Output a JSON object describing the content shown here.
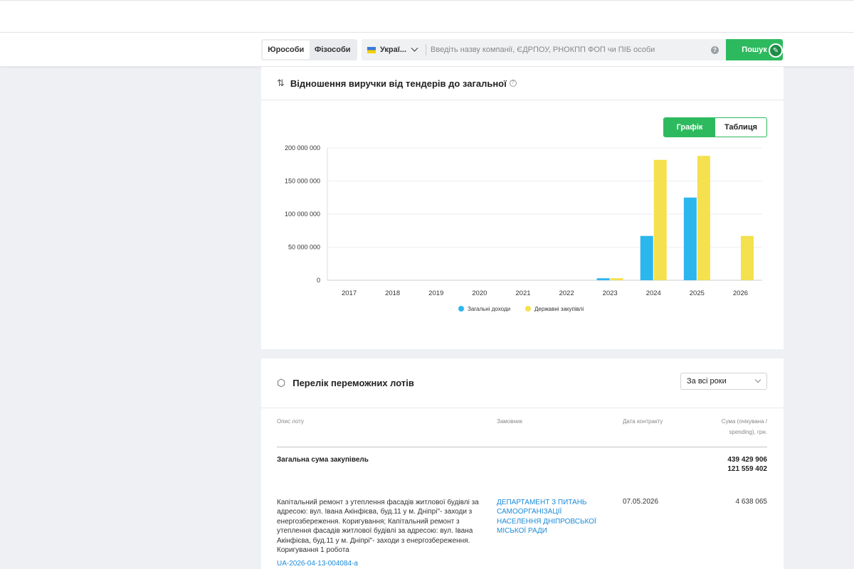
{
  "search": {
    "tabs": [
      "Юрособи",
      "Фізособи"
    ],
    "country": "Украї...",
    "placeholder": "Введіть назву компанії, ЄДРПОУ, РНОКПП ФОП чи ПІБ особи",
    "button": "Пошук",
    "help": "?"
  },
  "revenue_card": {
    "title": "Відношення виручки від тендерів до загальної",
    "toggle": [
      "Графік",
      "Таблиця"
    ]
  },
  "chart_data": {
    "type": "bar",
    "categories": [
      "2017",
      "2018",
      "2019",
      "2020",
      "2021",
      "2022",
      "2023",
      "2024",
      "2025",
      "2026"
    ],
    "series": [
      {
        "name": "Загальні доходи",
        "color": "#2cb6ee",
        "values": [
          0,
          0,
          0,
          0,
          0,
          0,
          3000000,
          67000000,
          125000000,
          0
        ]
      },
      {
        "name": "Державні закупівлі",
        "color": "#f5e04e",
        "values": [
          0,
          0,
          0,
          0,
          0,
          0,
          3000000,
          182000000,
          188000000,
          67000000
        ]
      }
    ],
    "yticks": [
      "200 000 000",
      "150 000 000",
      "100 000 000",
      "50 000 000",
      "0"
    ],
    "ylim": [
      0,
      200000000
    ],
    "grid": true,
    "legend_position": "bottom-center"
  },
  "lots_card": {
    "title": "Перелік переможних лотів",
    "filter": "За всі роки",
    "headers": {
      "desc": "Опис лоту",
      "customer": "Замовник",
      "date": "Дата контракту",
      "sum_line1": "Сума (очікувана /",
      "sum_line2": "spending), грн."
    },
    "total_label": "Загальна сума закупівель",
    "total_expected": "439 429 906",
    "total_spending": "121 559 402",
    "rows": [
      {
        "desc": "Капітальний ремонт з утеплення фасадів житлової будівлі за адресою: вул. Івана Акінфієва, буд.11 у м. Дніпрі\"- заходи з енергозбереження. Коригування; Капітальний ремонт з утеплення фасадів житлової будівлі за адресою: вул. Івана Акінфієва, буд.11 у м. Дніпрі\"- заходи з енергозбереження. Коригування 1 робота",
        "customer": "ДЕПАРТАМЕНТ З ПИТАНЬ САМООРГАНІЗАЦІЇ НАСЕЛЕННЯ ДНІПРОВСЬКОЇ МІСЬКОЇ РАДИ",
        "date": "07.05.2026",
        "amount": "4 638 065",
        "id": "UA-2026-04-13-004084-a"
      }
    ]
  }
}
